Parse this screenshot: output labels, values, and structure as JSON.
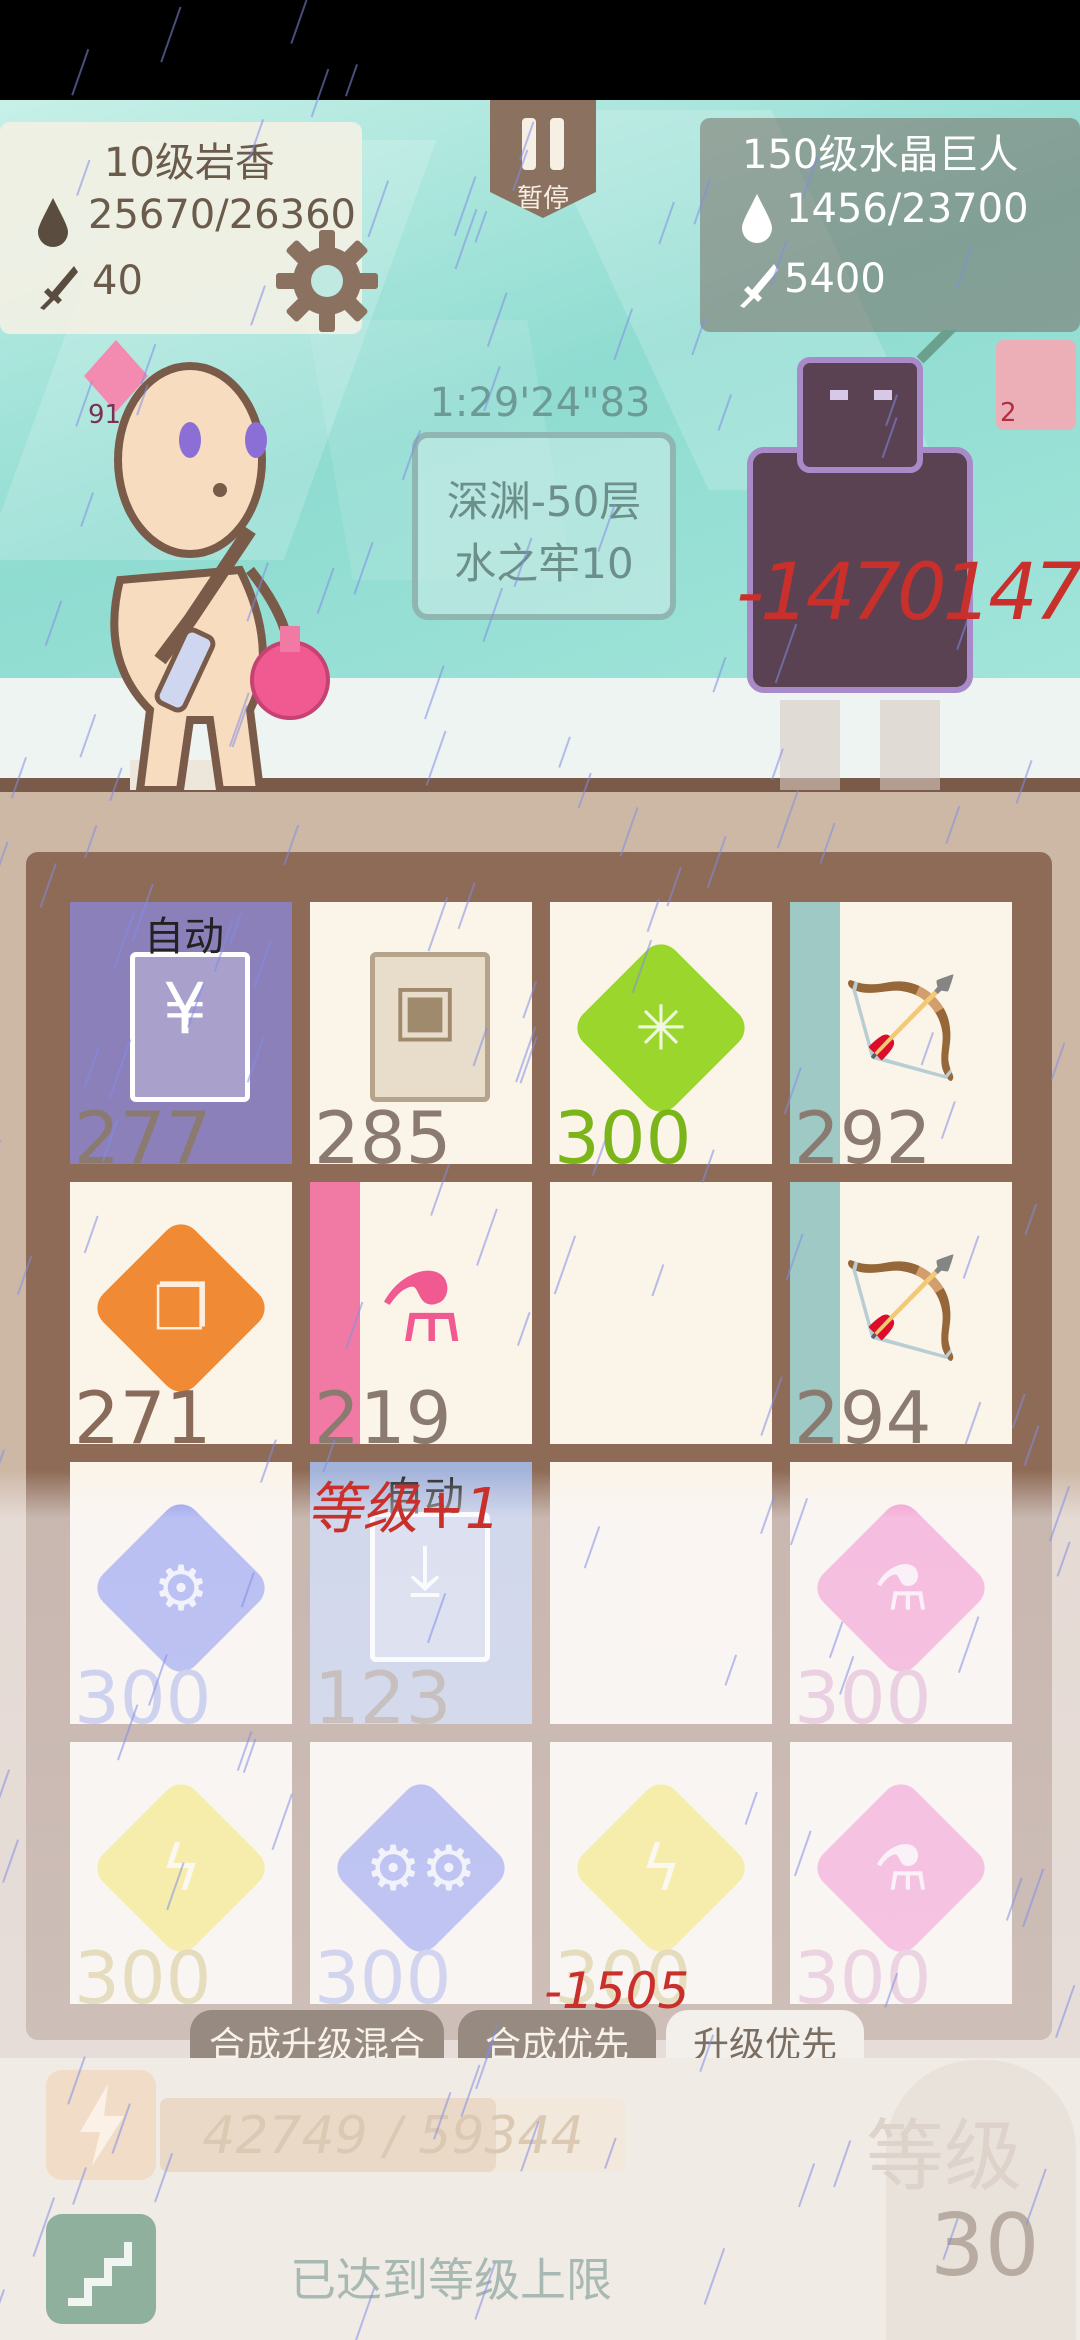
{
  "hud": {
    "player": {
      "name": "10级岩香",
      "hp": "25670/26360",
      "attack": "40",
      "badge_count": "91"
    },
    "enemy": {
      "name": "150级水晶巨人",
      "hp": "1456/23700",
      "attack": "5400",
      "badge_count": "2"
    },
    "pause_label": "暂停",
    "timer": "1:29'24\"83",
    "floor_line1": "深渊-50层",
    "floor_line2": "水之牢10",
    "floating_damage": "-1470",
    "floating_damage_2": "1470",
    "icons": [
      "blood-drop-icon",
      "sword-icon",
      "gear-icon",
      "pause-icon"
    ]
  },
  "grid": {
    "cells": [
      {
        "kind": "scroll",
        "glyph": "¥",
        "count": "277",
        "auto": "自动",
        "color": "#7b6fae"
      },
      {
        "kind": "scroll",
        "glyph": "▣",
        "count": "285",
        "color": "#c9b79e"
      },
      {
        "kind": "gem",
        "glyph": "✳",
        "count": "300",
        "color": "#9ad62c"
      },
      {
        "kind": "item",
        "glyph": "🏹",
        "count": "292",
        "color": "#9fc9c4"
      },
      {
        "kind": "gem",
        "glyph": "❐",
        "count": "271",
        "color": "#f08a34"
      },
      {
        "kind": "item",
        "glyph": "⚗",
        "count": "219",
        "color": "#f07aa4"
      },
      {
        "kind": "empty",
        "glyph": "",
        "count": "",
        "color": "#fbf4e9"
      },
      {
        "kind": "item",
        "glyph": "🏹",
        "count": "294",
        "color": "#9fc9c4"
      },
      {
        "kind": "gem",
        "glyph": "⚙",
        "count": "300",
        "color": "#6f7ee8"
      },
      {
        "kind": "scroll",
        "glyph": "⤓",
        "count": "123",
        "auto": "自动",
        "color": "#8aa0d8"
      },
      {
        "kind": "empty",
        "glyph": "",
        "count": "",
        "color": "#fbf4e9"
      },
      {
        "kind": "gem",
        "glyph": "⚗",
        "count": "300",
        "color": "#f27ac0"
      },
      {
        "kind": "gem",
        "glyph": "ϟ",
        "count": "300",
        "color": "#f2e040"
      },
      {
        "kind": "gem",
        "glyph": "⚙⚙",
        "count": "300",
        "color": "#6f7ee8"
      },
      {
        "kind": "gem",
        "glyph": "ϟ",
        "count": "300",
        "color": "#f2e040"
      },
      {
        "kind": "gem",
        "glyph": "⚗",
        "count": "300",
        "color": "#f27ac0"
      }
    ],
    "float_level": "等级+1",
    "float_damage": "-1505"
  },
  "tabs": [
    {
      "label": "合成升级混合",
      "active": false
    },
    {
      "label": "合成优先",
      "active": false
    },
    {
      "label": "升级优先",
      "active": true
    }
  ],
  "progress": {
    "xp_text": "42749 / 59344",
    "xp_fraction": 0.72,
    "max_level_text": "已达到等级上限",
    "level_label": "等级",
    "level_value": "30",
    "icons": [
      "lightning-icon",
      "stairs-icon"
    ]
  }
}
